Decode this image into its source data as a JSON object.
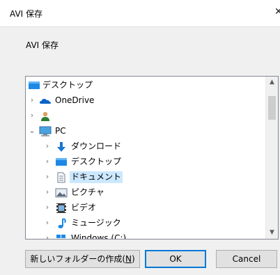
{
  "window": {
    "title": "AVI 保存",
    "close_glyph": "✕"
  },
  "prompt": "AVI 保存",
  "tree": {
    "items": [
      {
        "label": "デスクトップ",
        "icon": "desktop-icon",
        "expander": ""
      },
      {
        "label": "OneDrive",
        "icon": "onedrive-cloud-icon",
        "expander": "›"
      },
      {
        "label": "",
        "icon": "user-icon",
        "expander": "›"
      },
      {
        "label": "PC",
        "icon": "pc-icon",
        "expander": "⌄"
      },
      {
        "label": "ダウンロード",
        "icon": "download-arrow-icon",
        "expander": "›"
      },
      {
        "label": "デスクトップ",
        "icon": "desktop-icon",
        "expander": "›"
      },
      {
        "label": "ドキュメント",
        "icon": "document-icon",
        "expander": "›",
        "selected": true
      },
      {
        "label": "ピクチャ",
        "icon": "pictures-icon",
        "expander": "›"
      },
      {
        "label": "ビデオ",
        "icon": "video-icon",
        "expander": "›"
      },
      {
        "label": "ミュージック",
        "icon": "music-icon",
        "expander": "›"
      },
      {
        "label": "Windows (C:)",
        "icon": "drive-icon",
        "expander": "›"
      }
    ]
  },
  "buttons": {
    "new_folder": "新しいフォルダーの作成(",
    "new_folder_key": "N",
    "new_folder_end": ")",
    "ok": "OK",
    "cancel": "Cancel"
  },
  "colors": {
    "selection": "#cce8ff",
    "accent": "#0078d7"
  }
}
